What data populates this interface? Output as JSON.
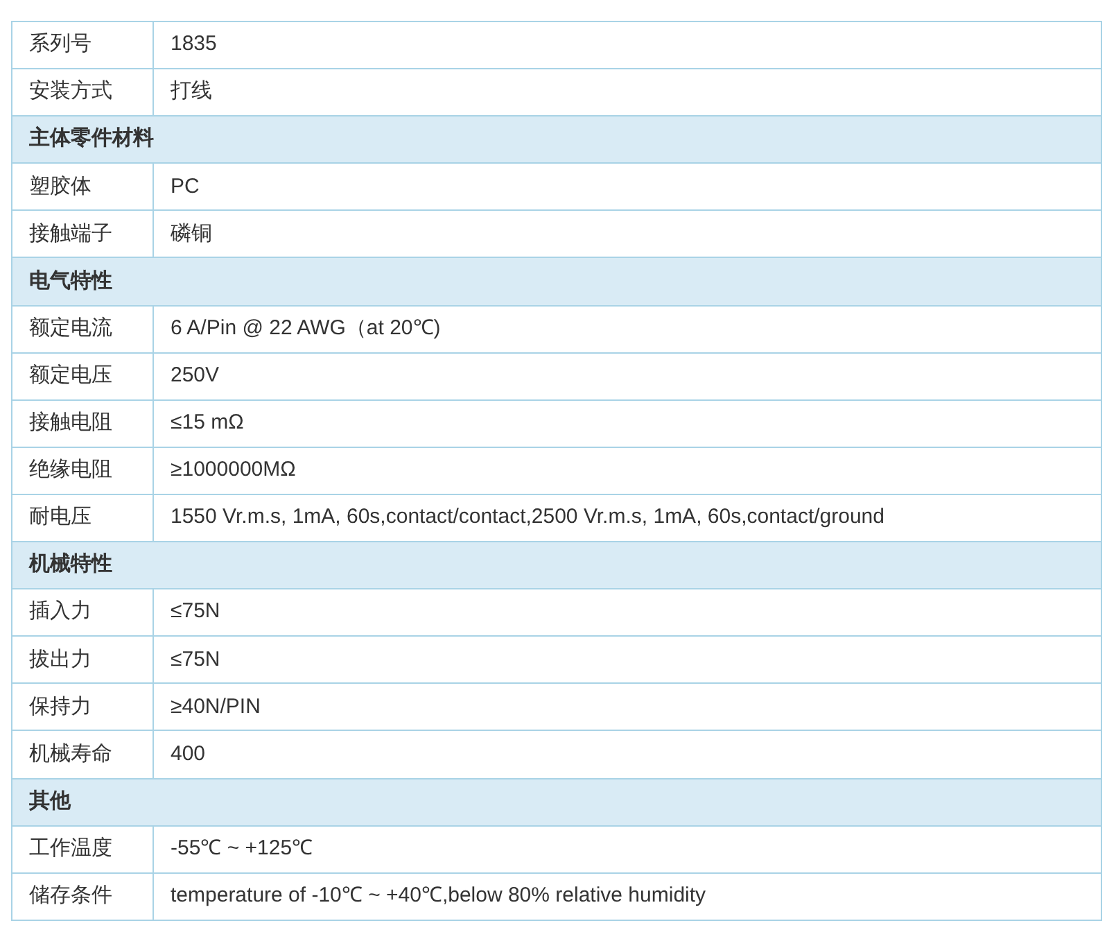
{
  "rows": [
    {
      "kind": "row",
      "label": "系列号",
      "value": "1835"
    },
    {
      "kind": "row",
      "label": "安装方式",
      "value": "打线"
    },
    {
      "kind": "section",
      "label": "主体零件材料"
    },
    {
      "kind": "row",
      "label": "塑胶体",
      "value": "PC"
    },
    {
      "kind": "row",
      "label": "接触端子",
      "value": "磷铜"
    },
    {
      "kind": "section",
      "label": "电气特性"
    },
    {
      "kind": "row",
      "label": "额定电流",
      "value": "6 A/Pin @ 22 AWG（at 20℃)"
    },
    {
      "kind": "row",
      "label": "额定电压",
      "value": "250V"
    },
    {
      "kind": "row",
      "label": "接触电阻",
      "value": "≤15 mΩ"
    },
    {
      "kind": "row",
      "label": "绝缘电阻",
      "value": "≥1000000MΩ"
    },
    {
      "kind": "row",
      "label": "耐电压",
      "value": "1550 Vr.m.s, 1mA, 60s,contact/contact,2500 Vr.m.s, 1mA, 60s,contact/ground"
    },
    {
      "kind": "section",
      "label": "机械特性"
    },
    {
      "kind": "row",
      "label": "插入力",
      "value": "≤75N"
    },
    {
      "kind": "row",
      "label": "拔出力",
      "value": "≤75N"
    },
    {
      "kind": "row",
      "label": "保持力",
      "value": "≥40N/PIN"
    },
    {
      "kind": "row",
      "label": "机械寿命",
      "value": "400"
    },
    {
      "kind": "section",
      "label": "其他"
    },
    {
      "kind": "row",
      "label": "工作温度",
      "value": "-55℃ ~ +125℃"
    },
    {
      "kind": "row",
      "label": "储存条件",
      "value": "temperature of -10℃ ~ +40℃,below 80% relative humidity"
    }
  ]
}
